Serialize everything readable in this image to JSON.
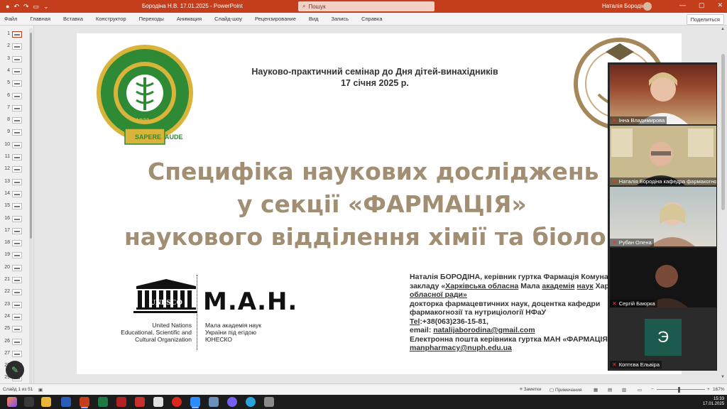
{
  "titlebar": {
    "doc_title": "Бородіна Н.В. 17.01.2025  -  PowerPoint",
    "search_placeholder": "Пошук",
    "user_name": "Наталія Бородіна"
  },
  "ribbon": {
    "tabs": [
      "Файл",
      "Главная",
      "Вставка",
      "Конструктор",
      "Переходы",
      "Анимация",
      "Слайд-шоу",
      "Рецензирование",
      "Вид",
      "Запись",
      "Справка"
    ],
    "share_label": "Поделиться"
  },
  "thumbnails": [
    "1",
    "2",
    "3",
    "4",
    "5",
    "6",
    "7",
    "8",
    "9",
    "10",
    "11",
    "12",
    "13",
    "14",
    "15",
    "16",
    "17",
    "18",
    "19",
    "20",
    "21",
    "22",
    "23",
    "24",
    "25",
    "26",
    "27",
    "28",
    "29"
  ],
  "slide": {
    "logo_left": {
      "year_top": "1805",
      "year_bottom": "1921",
      "motto_left": "SAPERE",
      "motto_right": "AUDE",
      "ring_text": "НАЦІОНАЛЬНИЙ ФАРМАЦЕВТИЧНИЙ УНІВЕРСИТЕТ"
    },
    "logo_right": {
      "ring_text": "Харківське територіальне відділення Малої академії наук"
    },
    "seminar_line1": "Науково-практичний семінар до Дня дітей-винахідників",
    "seminar_line2": "17 січня 2025 р.",
    "title_line1": "Специфіка наукових досліджень",
    "title_line2": "у секції «ФАРМАЦІЯ»",
    "title_line3": "наукового  відділення хімії та біології",
    "unesco_wordmark": "UNESCO",
    "unesco_text": [
      "United Nations",
      "Educational, Scientific and",
      "Cultural Organization"
    ],
    "man_wordmark": "М.А.Н.",
    "man_text": [
      "Мала академія наук",
      "України під егідою",
      "ЮНЕСКО"
    ],
    "contact": {
      "line1": "Наталія БОРОДІНА, керівник гуртка Фармація Комунального",
      "line2_a": "закладу «",
      "line2_b": "Харківська обласна",
      "line2_c": " Мала ",
      "line2_d": "академія",
      "line2_e": " ",
      "line2_f": "наук",
      "line2_g": " Харківської",
      "line3": "обласної ради»",
      "line4": "докторка фармацевтичних наук, доцентка кафедри",
      "line5": "фармакогнозії та нутриціології НФаУ",
      "line6_a": "Tel",
      "line6_b": ":+38(063)236-15-81,",
      "line7_a": "email: ",
      "line7_b": "natalijaborodina@gmail.com",
      "line8": "Електронна пошта керівника гуртка МАН «ФАРМАЦІЯ»",
      "line9": "manpharmacy@nuph.edu.ua"
    }
  },
  "participants": [
    {
      "name": "Інна Владимирова"
    },
    {
      "name": "Наталія Бородіна кафедра фармакогнозії"
    },
    {
      "name": "Рубан Олена"
    },
    {
      "name": "Сергій Баюрка"
    },
    {
      "name": "Коптєва Ельвіра",
      "initial": "Э"
    }
  ],
  "statusbar": {
    "slide_counter": "Слайд 1 из 51",
    "notes_label": "Заметки",
    "comments_label": "Примечания",
    "zoom": "167%"
  },
  "taskbar": {
    "time": "15:33",
    "date": "17.01.2025"
  },
  "colors": {
    "accent": "#c43e1c",
    "title_text": "#a18e73",
    "logo_green": "#2e8a35",
    "logo_gold": "#d9b43a"
  }
}
